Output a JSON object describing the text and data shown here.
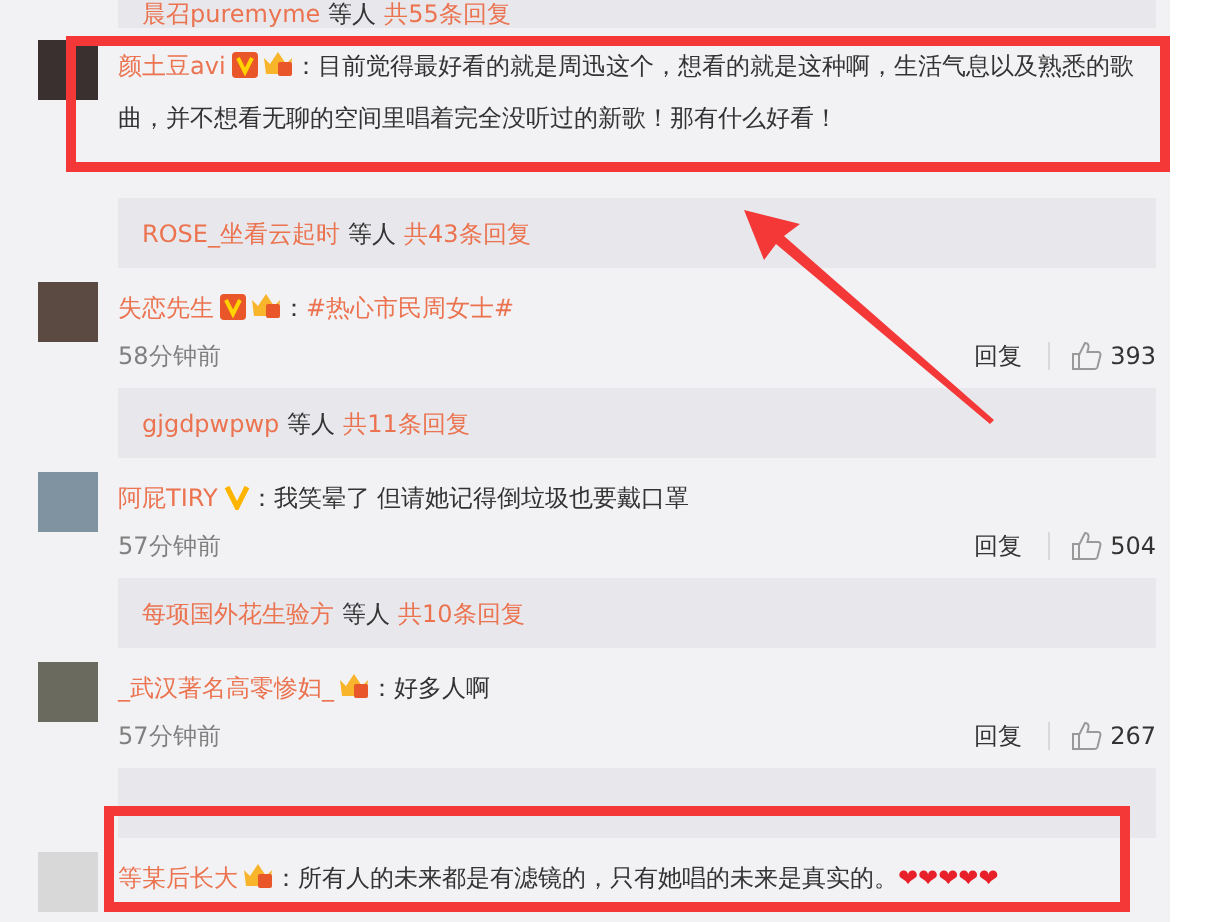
{
  "top_reply_summary": {
    "users": "晨召puremyme",
    "others": "等人",
    "count": "共55条回复"
  },
  "comments": [
    {
      "user": "颜土豆avi",
      "verified": true,
      "verified_boxed": true,
      "crown": true,
      "text": "：目前觉得最好看的就是周迅这个，想看的就是这种啊，生活气息以及熟悉的歌曲，并不想看无聊的空间里唱着完全没听过的新歌！那有什么好看！",
      "highlighted": true,
      "replies": {
        "users": "ROSE_坐看云起时",
        "others": "等人",
        "count": "共43条回复"
      }
    },
    {
      "user": "失恋先生",
      "verified": true,
      "verified_boxed": true,
      "crown": true,
      "text": "：",
      "topic": "#热心市民周女士#",
      "time": "58分钟前",
      "reply": "回复",
      "likes": "393",
      "highlighted": false,
      "replies": {
        "users": "gjgdpwpwp",
        "others": "等人",
        "count": "共11条回复"
      }
    },
    {
      "user": "阿屁TIRY",
      "verified": true,
      "verified_boxed": false,
      "crown": false,
      "text": "：我笑晕了 但请她记得倒垃圾也要戴口罩",
      "time": "57分钟前",
      "reply": "回复",
      "likes": "504",
      "highlighted": false,
      "replies": {
        "users": "每项国外花生验方",
        "others": "等人",
        "count": "共10条回复"
      }
    },
    {
      "user": "_武汉著名高零惨妇_",
      "verified": false,
      "crown": true,
      "text": "：好多人啊",
      "time": "57分钟前",
      "reply": "回复",
      "likes": "267",
      "highlighted": false,
      "reply_panel": true
    },
    {
      "user": "等某后长大",
      "verified": false,
      "crown": true,
      "text": "：所有人的未来都是有滤镜的，只有她唱的未来是真实的。",
      "hearts": "❤❤❤❤❤",
      "highlighted": true
    }
  ],
  "annotation_arrow": true
}
